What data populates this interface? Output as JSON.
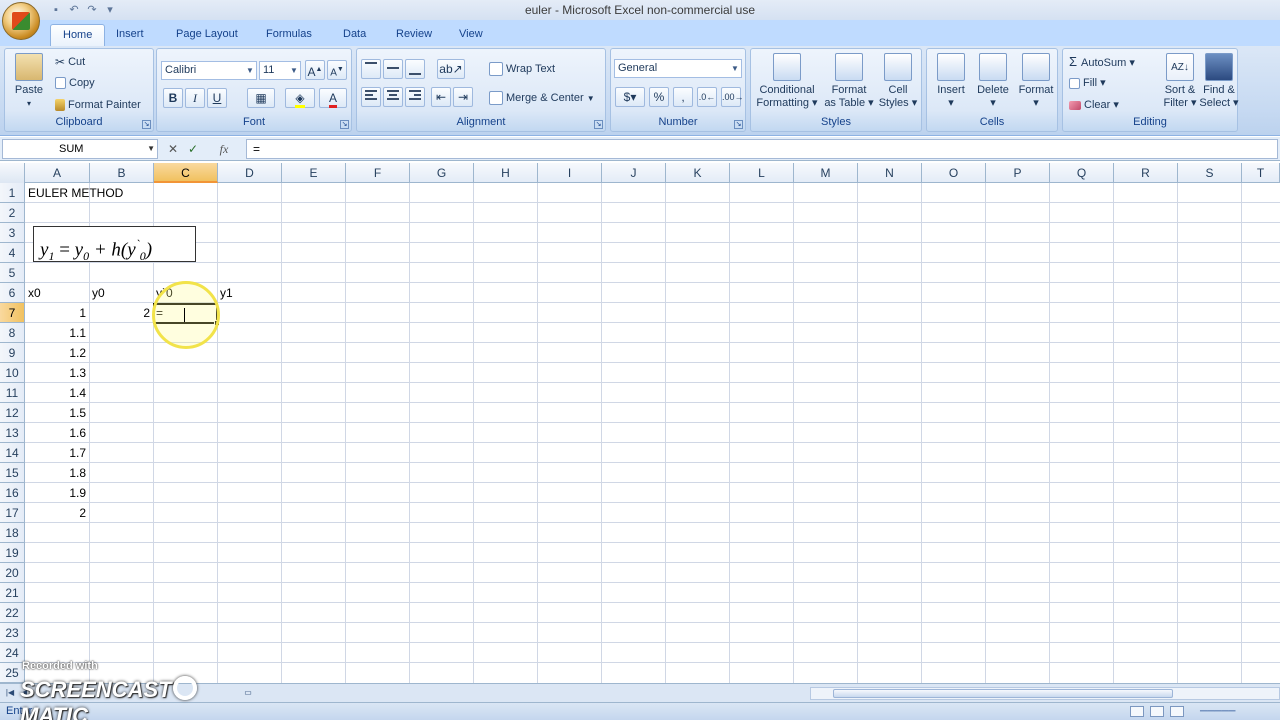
{
  "window": {
    "title": "euler - Microsoft Excel non-commercial use"
  },
  "tabs": [
    "Home",
    "Insert",
    "Page Layout",
    "Formulas",
    "Data",
    "Review",
    "View"
  ],
  "ribbon": {
    "clipboard": {
      "label": "Clipboard",
      "paste": "Paste",
      "cut": "Cut",
      "copy": "Copy",
      "format_painter": "Format Painter"
    },
    "font": {
      "label": "Font",
      "font_name": "Calibri",
      "font_size": "11",
      "bold": "B",
      "italic": "I",
      "underline": "U"
    },
    "alignment": {
      "label": "Alignment",
      "wrap_text": "Wrap Text",
      "merge_center": "Merge & Center"
    },
    "number": {
      "label": "Number",
      "format": "General",
      "percent": "%",
      "comma": ","
    },
    "styles": {
      "label": "Styles",
      "conditional_1": "Conditional",
      "conditional_2": "Formatting",
      "format_table_1": "Format",
      "format_table_2": "as Table",
      "cell_styles_1": "Cell",
      "cell_styles_2": "Styles"
    },
    "cells": {
      "label": "Cells",
      "insert": "Insert",
      "delete": "Delete",
      "format": "Format"
    },
    "editing": {
      "label": "Editing",
      "autosum": "AutoSum",
      "fill": "Fill",
      "clear": "Clear",
      "sort_1": "Sort &",
      "sort_2": "Filter",
      "find_1": "Find &",
      "find_2": "Select"
    }
  },
  "formula_bar": {
    "name_box": "SUM",
    "fx": "fx",
    "formula": "="
  },
  "columns": [
    "A",
    "B",
    "C",
    "D",
    "E",
    "F",
    "G",
    "H",
    "I",
    "J",
    "K",
    "L",
    "M",
    "N",
    "O",
    "P",
    "Q",
    "R",
    "S",
    "T"
  ],
  "rows": [
    "1",
    "2",
    "3",
    "4",
    "5",
    "6",
    "7",
    "8",
    "9",
    "10",
    "11",
    "12",
    "13",
    "14",
    "15",
    "16",
    "17",
    "18",
    "19",
    "20",
    "21",
    "22",
    "23",
    "24",
    "25"
  ],
  "cells": {
    "a1": "EULER METHOD",
    "a6": "x0",
    "b6": "y0",
    "c6": "y`0",
    "d6": "y1",
    "a7": "1",
    "b7": "2",
    "c7": "=",
    "a8": "1.1",
    "a9": "1.2",
    "a10": "1.3",
    "a11": "1.4",
    "a12": "1.5",
    "a13": "1.6",
    "a14": "1.7",
    "a15": "1.8",
    "a16": "1.9",
    "a17": "2"
  },
  "equation": {
    "y": "y",
    "sub1": "1",
    "eq": " = ",
    "y0": "y",
    "sub0": "0",
    "plus": " + h(y",
    "prime": "`",
    "sub0b": "0",
    "close": ")"
  },
  "status": {
    "mode": "Enter"
  },
  "watermark": {
    "line1": "Recorded with",
    "line2a": "SCREENCAST",
    "line2b": "MATIC"
  }
}
